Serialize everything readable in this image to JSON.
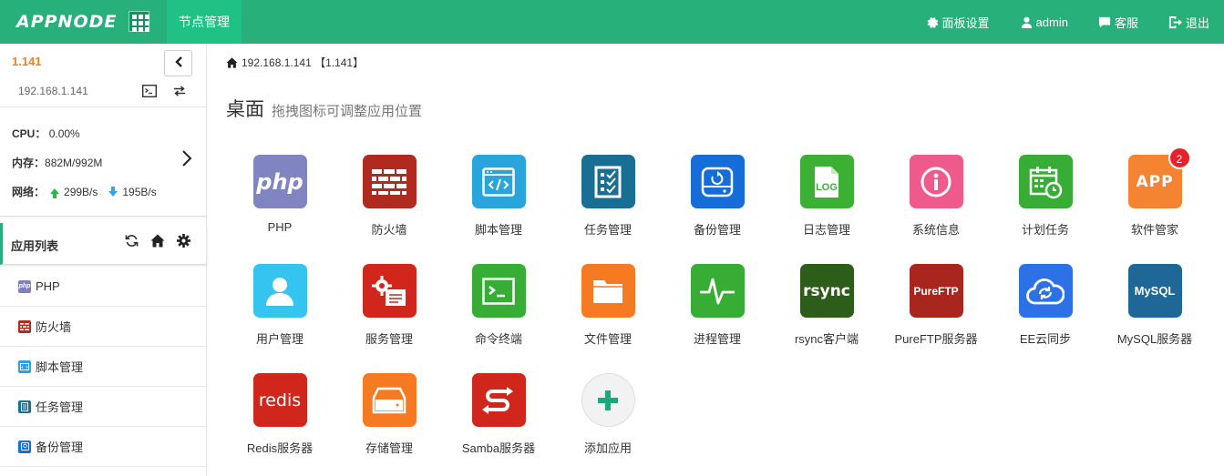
{
  "header": {
    "logo": "APPNODE",
    "nav_active": "节点管理",
    "settings_label": "面板设置",
    "user_label": "admin",
    "service_label": "客服",
    "logout_label": "退出"
  },
  "node": {
    "name": "1.141",
    "ip": "192.168.1.141",
    "cpu_label": "CPU：",
    "cpu_value": "0.00%",
    "mem_label": "内存：",
    "mem_value": "882M/992M",
    "net_label": "网络：",
    "net_up": "299B/s",
    "net_down": "195B/s"
  },
  "applist": {
    "title": "应用列表",
    "items": [
      {
        "label": "PHP",
        "icon": "php-icon",
        "color": "#8080c0"
      },
      {
        "label": "防火墙",
        "icon": "firewall-icon",
        "color": "#b22a1e"
      },
      {
        "label": "脚本管理",
        "icon": "script-icon",
        "color": "#29a3dc"
      },
      {
        "label": "任务管理",
        "icon": "task-icon",
        "color": "#1a6f96"
      },
      {
        "label": "备份管理",
        "icon": "backup-icon",
        "color": "#1a6fd6"
      }
    ]
  },
  "main": {
    "breadcrumb": "192.168.1.141 【1.141】",
    "title": "桌面",
    "subtitle": "拖拽图标可调整应用位置"
  },
  "apps": [
    {
      "label": "PHP",
      "icon": "php-icon",
      "color": "#8085c2"
    },
    {
      "label": "防火墙",
      "icon": "firewall-icon",
      "color": "#b02a1f"
    },
    {
      "label": "脚本管理",
      "icon": "script-icon",
      "color": "#2aa4dd"
    },
    {
      "label": "任务管理",
      "icon": "task-icon",
      "color": "#196e93"
    },
    {
      "label": "备份管理",
      "icon": "backup-icon",
      "color": "#156dd8"
    },
    {
      "label": "日志管理",
      "icon": "log-icon",
      "color": "#3cb035"
    },
    {
      "label": "系统信息",
      "icon": "info-icon",
      "color": "#ee5a8c"
    },
    {
      "label": "计划任务",
      "icon": "calendar-icon",
      "color": "#38ad35"
    },
    {
      "label": "软件管家",
      "icon": "app-store-icon",
      "color": "#f48332",
      "badge": "2"
    },
    {
      "label": "用户管理",
      "icon": "user-icon",
      "color": "#35c3f0"
    },
    {
      "label": "服务管理",
      "icon": "service-icon",
      "color": "#d0261c"
    },
    {
      "label": "命令终端",
      "icon": "terminal-icon",
      "color": "#38ad35"
    },
    {
      "label": "文件管理",
      "icon": "folder-icon",
      "color": "#f57a22"
    },
    {
      "label": "进程管理",
      "icon": "process-icon",
      "color": "#38ad35"
    },
    {
      "label": "rsync客户端",
      "icon": "rsync-icon",
      "color": "#2c5e1a",
      "text": "rsync"
    },
    {
      "label": "PureFTP服务器",
      "icon": "pureftp-icon",
      "color": "#a8261d",
      "text": "PureFTP"
    },
    {
      "label": "EE云同步",
      "icon": "cloud-sync-icon",
      "color": "#2c72e6"
    },
    {
      "label": "MySQL服务器",
      "icon": "mysql-icon",
      "color": "#1f6797",
      "text": "MySQL"
    },
    {
      "label": "Redis服务器",
      "icon": "redis-icon",
      "color": "#d0261c",
      "text": "redis"
    },
    {
      "label": "存储管理",
      "icon": "storage-icon",
      "color": "#f57a22"
    },
    {
      "label": "Samba服务器",
      "icon": "samba-icon",
      "color": "#d0261c"
    },
    {
      "label": "添加应用",
      "icon": "add-icon",
      "color": "#f2f2f2"
    }
  ]
}
